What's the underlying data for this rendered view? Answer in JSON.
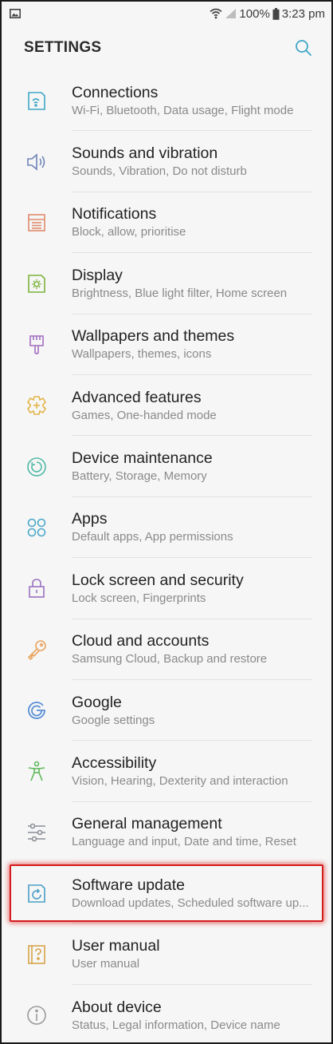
{
  "status_bar": {
    "battery": "100%",
    "time": "3:23 pm"
  },
  "header": {
    "title": "SETTINGS"
  },
  "items": [
    {
      "title": "Connections",
      "subtitle": "Wi-Fi, Bluetooth, Data usage, Flight mode",
      "icon": "connections-icon",
      "color": "#3fa7c7"
    },
    {
      "title": "Sounds and vibration",
      "subtitle": "Sounds, Vibration, Do not disturb",
      "icon": "speaker-icon",
      "color": "#6f83b8"
    },
    {
      "title": "Notifications",
      "subtitle": "Block, allow, prioritise",
      "icon": "notifications-icon",
      "color": "#e08b6d"
    },
    {
      "title": "Display",
      "subtitle": "Brightness, Blue light filter, Home screen",
      "icon": "display-icon",
      "color": "#7bb33d"
    },
    {
      "title": "Wallpapers and themes",
      "subtitle": "Wallpapers, themes, icons",
      "icon": "brush-icon",
      "color": "#a26fbf"
    },
    {
      "title": "Advanced features",
      "subtitle": "Games, One-handed mode",
      "icon": "gear-plus-icon",
      "color": "#e3b54a"
    },
    {
      "title": "Device maintenance",
      "subtitle": "Battery, Storage, Memory",
      "icon": "maintenance-icon",
      "color": "#4fb9a4"
    },
    {
      "title": "Apps",
      "subtitle": "Default apps, App permissions",
      "icon": "apps-icon",
      "color": "#4aa8c9"
    },
    {
      "title": "Lock screen and security",
      "subtitle": "Lock screen, Fingerprints",
      "icon": "lock-icon",
      "color": "#9b72c0"
    },
    {
      "title": "Cloud and accounts",
      "subtitle": "Samsung Cloud, Backup and restore",
      "icon": "key-icon",
      "color": "#e9a35e"
    },
    {
      "title": "Google",
      "subtitle": "Google settings",
      "icon": "google-icon",
      "color": "#5a8fd6"
    },
    {
      "title": "Accessibility",
      "subtitle": "Vision, Hearing, Dexterity and interaction",
      "icon": "accessibility-icon",
      "color": "#5fb85a"
    },
    {
      "title": "General management",
      "subtitle": "Language and input, Date and time, Reset",
      "icon": "sliders-icon",
      "color": "#8a8f96"
    },
    {
      "title": "Software update",
      "subtitle": "Download updates, Scheduled software up...",
      "icon": "software-update-icon",
      "color": "#4a9fc6"
    },
    {
      "title": "User manual",
      "subtitle": "User manual",
      "icon": "manual-icon",
      "color": "#d6a347"
    },
    {
      "title": "About device",
      "subtitle": "Status, Legal information, Device name",
      "icon": "info-icon",
      "color": "#9a9a9a"
    }
  ]
}
